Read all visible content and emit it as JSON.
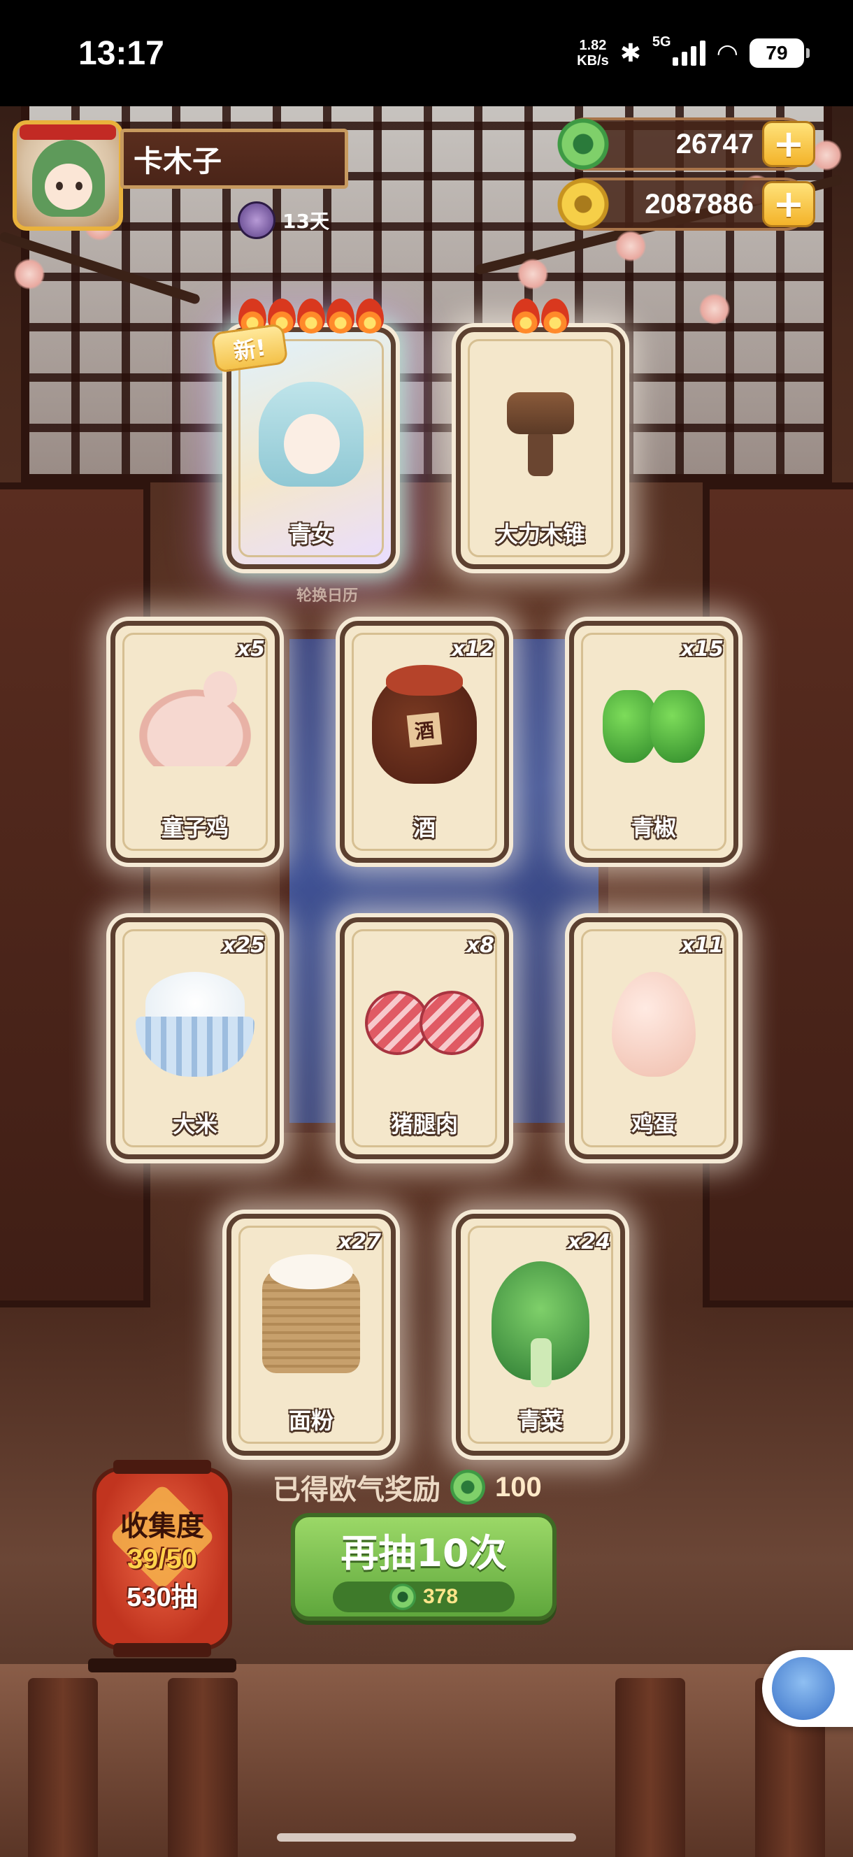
{
  "status_bar": {
    "time": "13:17",
    "net_speed_value": "1.82",
    "net_speed_unit": "KB/s",
    "network": "5G",
    "battery": "79"
  },
  "player": {
    "name": "卡木子",
    "days": "13天"
  },
  "currencies": {
    "jade": "26747",
    "coins": "2087886",
    "plus_label": "+"
  },
  "featured_cards": [
    {
      "name": "青女",
      "flames": 5,
      "new_label": "新!"
    },
    {
      "name": "大力木锥",
      "flames": 2
    }
  ],
  "featured_caption": "轮换日历",
  "cards": [
    {
      "name": "童子鸡",
      "count": "x5"
    },
    {
      "name": "酒",
      "count": "x12"
    },
    {
      "name": "青椒",
      "count": "x15"
    },
    {
      "name": "大米",
      "count": "x25"
    },
    {
      "name": "猪腿肉",
      "count": "x8"
    },
    {
      "name": "鸡蛋",
      "count": "x11"
    },
    {
      "name": "面粉",
      "count": "x27"
    },
    {
      "name": "青菜",
      "count": "x24"
    }
  ],
  "reward": {
    "label": "已得欧气奖励",
    "amount": "100"
  },
  "draw_button": {
    "label": "再抽10次",
    "cost": "378"
  },
  "collection": {
    "label": "收集度",
    "progress": "39/50",
    "draws": "530抽"
  },
  "colors": {
    "button_green": "#7cc352",
    "lantern_red": "#d8452b",
    "gold": "#f3b32a"
  }
}
